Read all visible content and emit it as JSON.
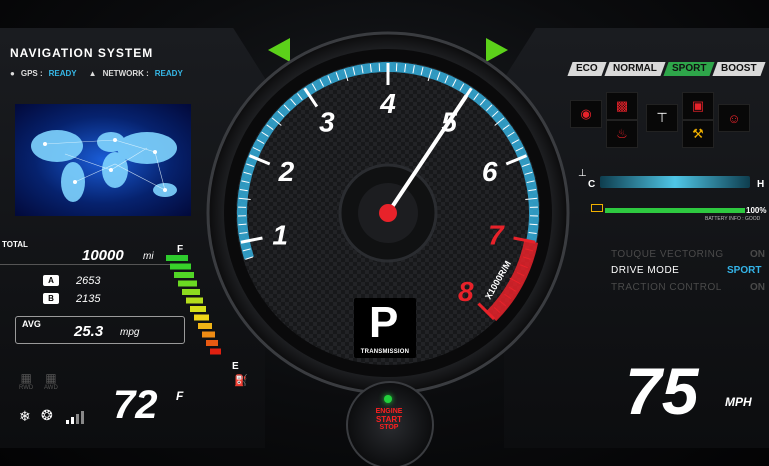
{
  "navigation": {
    "title": "NAVIGATION SYSTEM",
    "gps_label": "GPS :",
    "gps_status": "READY",
    "network_label": "NETWORK :",
    "network_status": "READY"
  },
  "odometer": {
    "total_label": "TOTAL",
    "total_value": "10000",
    "total_unit": "mi",
    "trip_a_label": "A",
    "trip_a_value": "2653",
    "trip_b_label": "B",
    "trip_b_value": "2135",
    "avg_label": "AVG",
    "avg_value": "25.3",
    "avg_unit": "mpg"
  },
  "fuel": {
    "full_label": "F",
    "empty_label": "E",
    "level_fraction": 1.0
  },
  "drive_icons": {
    "rwd_label": "RWD",
    "awd_label": "AWD"
  },
  "climate": {
    "temperature": "72",
    "unit": "F"
  },
  "tachometer": {
    "tick_labels": [
      "1",
      "2",
      "3",
      "4",
      "5",
      "6",
      "7",
      "8"
    ],
    "redline_start": 7,
    "max": 8,
    "needle_value": 5,
    "scale_label": "X1000R/M"
  },
  "transmission": {
    "gear": "P",
    "label": "TRANSMISSION"
  },
  "start_button": {
    "line1": "ENGINE",
    "line2": "START",
    "line3": "STOP"
  },
  "drive_modes": {
    "items": [
      "ECO",
      "NORMAL",
      "SPORT",
      "BOOST"
    ],
    "active": "SPORT"
  },
  "engine_temp": {
    "cold_label": "C",
    "hot_label": "H"
  },
  "battery": {
    "percent_label": "100%",
    "level_fraction": 1.0,
    "info": "BATTERY INFO : GOOD"
  },
  "settings": [
    {
      "label": "TOUQUE VECTORING",
      "value": "ON",
      "active": false
    },
    {
      "label": "DRIVE MODE",
      "value": "SPORT",
      "active": true
    },
    {
      "label": "TRACTION CONTROL",
      "value": "ON",
      "active": false
    }
  ],
  "speed": {
    "value": "75",
    "unit": "MPH"
  },
  "colors": {
    "accent_blue": "#36b8e8",
    "redline": "#e8222a",
    "active_mode": "#2ea64a",
    "arrow_green": "#5cd11a"
  }
}
